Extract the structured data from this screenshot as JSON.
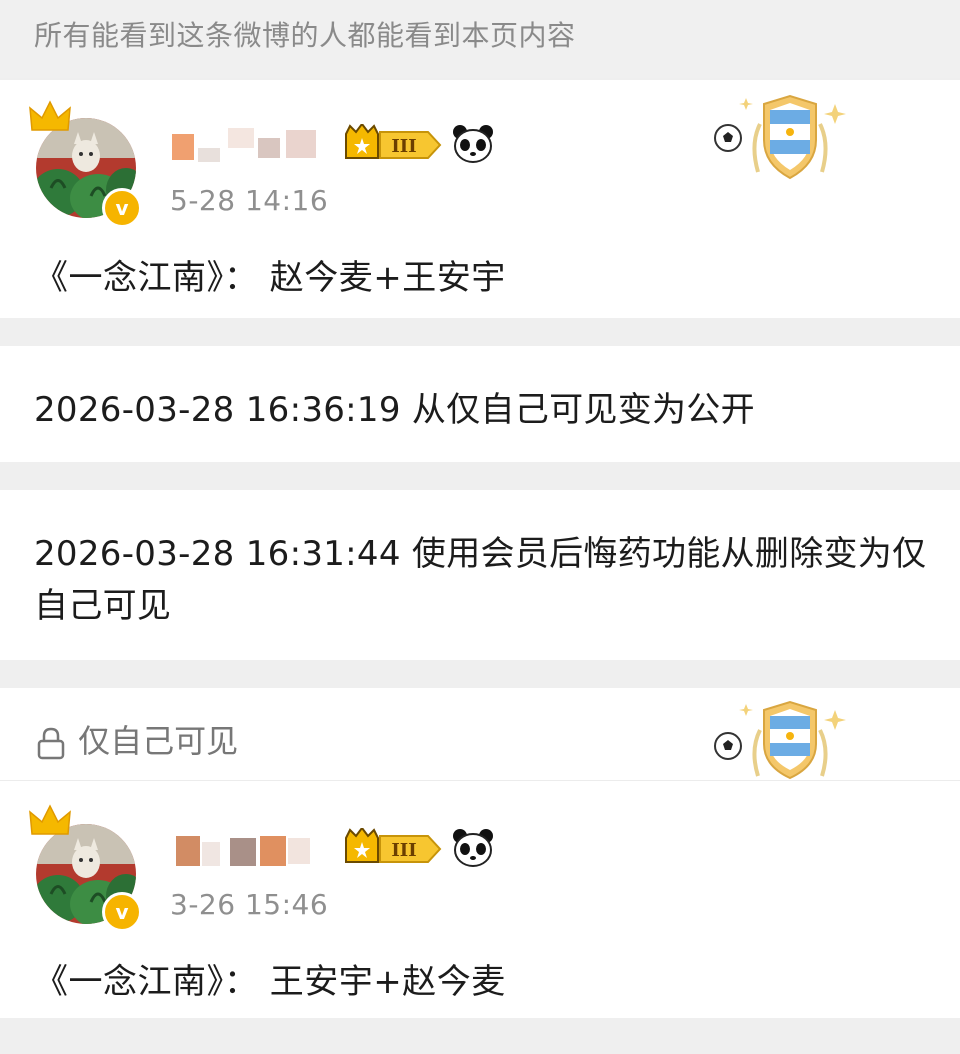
{
  "visibility_notice": "所有能看到这条微博的人都能看到本页内容",
  "post_current": {
    "timestamp": "5-28 14:16",
    "content": "《一念江南》： 赵今麦+王安宇",
    "level_badge": "III"
  },
  "edit_history": [
    {
      "text": "2026-03-28 16:36:19 从仅自己可见变为公开"
    },
    {
      "text": "2026-03-28 16:31:44 使用会员后悔药功能从删除变为仅自己可见"
    }
  ],
  "post_original": {
    "visibility_label": "仅自己可见",
    "timestamp": "3-26 15:46",
    "content": "《一念江南》： 王安宇+赵今麦",
    "level_badge": "III"
  },
  "colors": {
    "verified": "#f6b400",
    "crown": "#f5b800",
    "muted": "#8f8f8f",
    "argentina_blue": "#6cace4"
  }
}
